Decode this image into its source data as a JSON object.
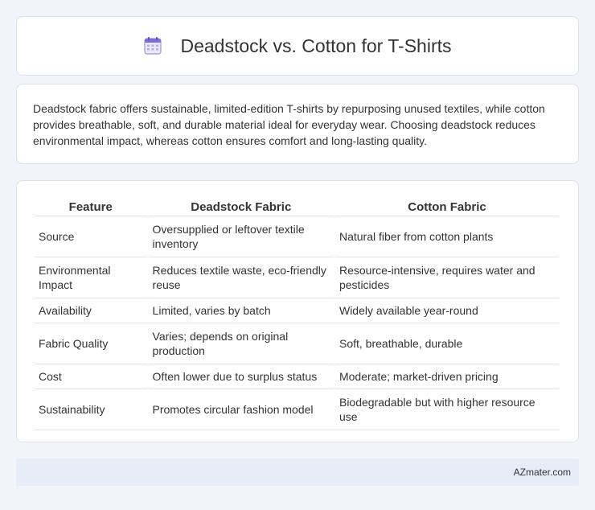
{
  "header": {
    "title": "Deadstock vs. Cotton for T-Shirts",
    "icon": "calendar-icon",
    "accent": "#7b6fd6"
  },
  "intro": {
    "text": "Deadstock fabric offers sustainable, limited-edition T-shirts by repurposing unused textiles, while cotton provides breathable, soft, and durable material ideal for everyday wear. Choosing deadstock reduces environmental impact, whereas cotton ensures comfort and long-lasting quality."
  },
  "table": {
    "headers": [
      "Feature",
      "Deadstock Fabric",
      "Cotton Fabric"
    ],
    "rows": [
      [
        "Source",
        "Oversupplied or leftover textile inventory",
        "Natural fiber from cotton plants"
      ],
      [
        "Environmental Impact",
        "Reduces textile waste, eco-friendly reuse",
        "Resource-intensive, requires water and pesticides"
      ],
      [
        "Availability",
        "Limited, varies by batch",
        "Widely available year-round"
      ],
      [
        "Fabric Quality",
        "Varies; depends on original production",
        "Soft, breathable, durable"
      ],
      [
        "Cost",
        "Often lower due to surplus status",
        "Moderate; market-driven pricing"
      ],
      [
        "Sustainability",
        "Promotes circular fashion model",
        "Biodegradable but with higher resource use"
      ]
    ]
  },
  "footer": {
    "brand": "AZmater.com"
  }
}
